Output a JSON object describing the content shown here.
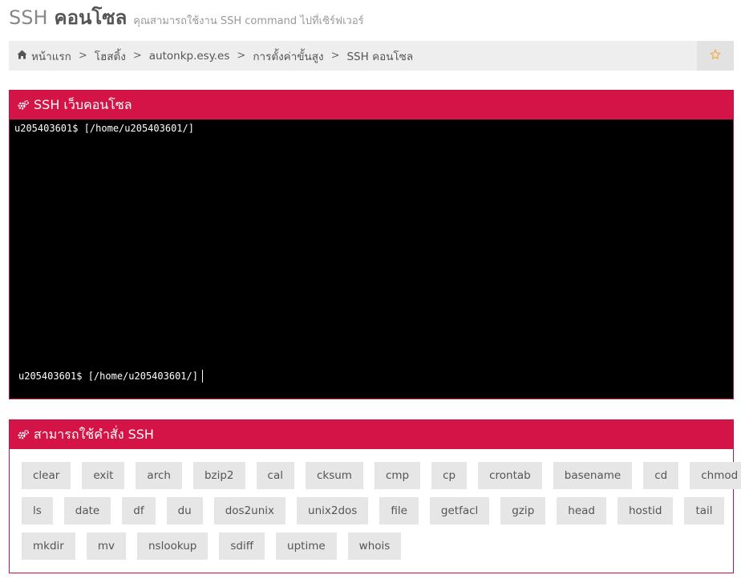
{
  "page": {
    "title": "SSH",
    "title_bold": "คอนโซล",
    "subtitle": "คุณสามารถใช้งาน SSH command ไปที่เซิร์ฟเวอร์"
  },
  "breadcrumb": {
    "home": "หน้าแรก",
    "hosting": "โฮสติ้ง",
    "domain": "autonkp.esy.es",
    "advanced": "การตั้งค่าขั้นสูง",
    "current": "SSH คอนโซล",
    "separator": ">"
  },
  "icons": {
    "home": "home-icon",
    "star": "star-icon",
    "cogs": "cogs-icon"
  },
  "colors": {
    "accent": "#d41446",
    "star": "#f0ad4e"
  },
  "console_panel": {
    "title": "SSH เว็บคอนโซล",
    "output_line": "u205403601$ [/home/u205403601/]",
    "prompt": "u205403601$ [/home/u205403601/]"
  },
  "commands_panel": {
    "title": "สามารถใช้คำสั่ง SSH",
    "rows": [
      [
        "clear",
        "exit",
        "arch",
        "bzip2",
        "cal",
        "cksum",
        "cmp",
        "cp",
        "crontab",
        "basename",
        "cd",
        "chmod"
      ],
      [
        "ls",
        "date",
        "df",
        "du",
        "dos2unix",
        "unix2dos",
        "file",
        "getfacl",
        "gzip",
        "head",
        "hostid",
        "tail"
      ],
      [
        "mkdir",
        "mv",
        "nslookup",
        "sdiff",
        "uptime",
        "whois"
      ]
    ]
  }
}
